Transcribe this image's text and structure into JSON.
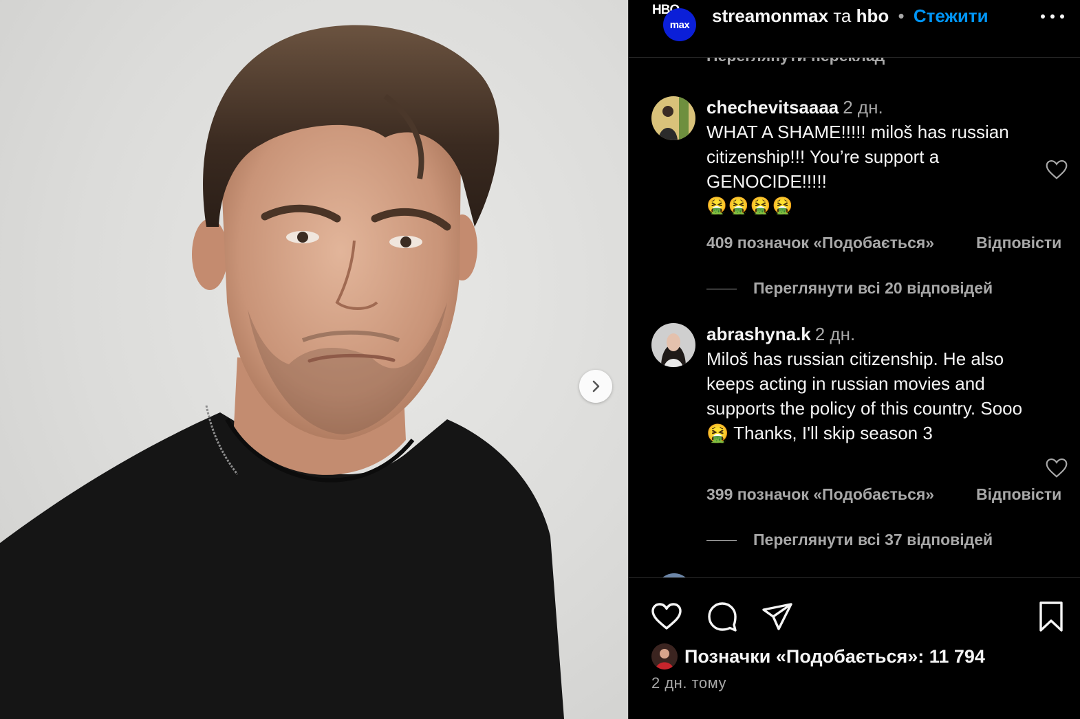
{
  "photo": {
    "subject": "portrait-photo",
    "background_color": "#dcdcda"
  },
  "carousel": {
    "next_icon": "chevron-right-icon"
  },
  "header": {
    "account_logo_top": "HBO",
    "account_logo_main": "max",
    "username": "streamonmax",
    "connector": "та",
    "collaborator": "hbo",
    "separator": "•",
    "follow_label": "Стежити",
    "more_icon": "more-horizontal-icon"
  },
  "comments": {
    "translate_label": "Переглянути переклад",
    "items": [
      {
        "username": "chechevitsaaaa",
        "time": "2 дн.",
        "text": "WHAT A SHAME!!!!! miloš has russian citizenship!!! You’re support a GENOCIDE!!!!!",
        "emoji": "🤮🤮🤮🤮",
        "likes": "409 позначок «Подобається»",
        "reply_label": "Відповісти",
        "view_replies": "Переглянути всі 20 відповідей"
      },
      {
        "username": "abrashyna.k",
        "time": "2 дн.",
        "text_before_emoji": "Miloš has russian citizenship. He also keeps acting in russian movies and supports the policy of this country. Sooo",
        "emoji": "🤮",
        "text_after_emoji": "Thanks, I'll skip season 3",
        "likes": "399 позначок «Подобається»",
        "reply_label": "Відповісти",
        "view_replies": "Переглянути всі 37 відповідей"
      }
    ]
  },
  "actions": {
    "like_icon": "heart-icon",
    "comment_icon": "comment-icon",
    "share_icon": "send-icon",
    "save_icon": "bookmark-icon"
  },
  "post_meta": {
    "likes_label": "Позначки «Подобається»: 11 794",
    "posted": "2 дн. тому"
  }
}
